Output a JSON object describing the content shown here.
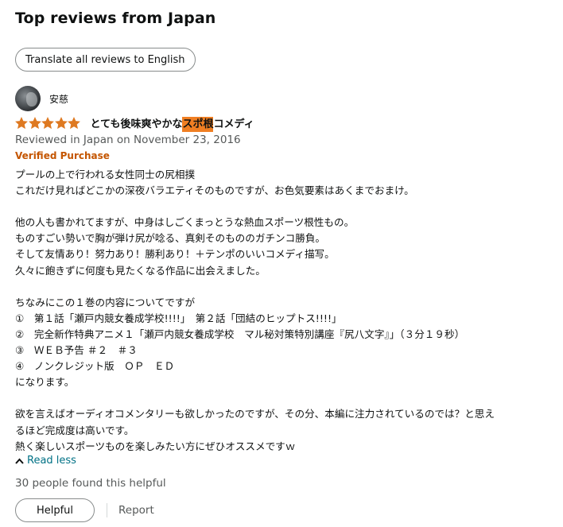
{
  "section": {
    "heading": "Top reviews from Japan",
    "translate_label": "Translate all reviews to English"
  },
  "review": {
    "author": "安慈",
    "rating": 5,
    "rating_max": 5,
    "star_color": "#de7921",
    "title_before": "とても後味爽やかな",
    "title_highlight": "スポ根",
    "title_after": "コメディ",
    "highlight_color": "#f07f23",
    "date": "Reviewed in Japan on November 23, 2016",
    "verified": "Verified Purchase",
    "verified_color": "#c45500",
    "body_lines": [
      "プールの上で行われる女性同士の尻相撲",
      "これだけ見ればどこかの深夜バラエティそのものですが、お色気要素はあくまでおまけ。",
      "",
      "他の人も書かれてますが、中身はしごくまっとうな熱血スポーツ根性もの。",
      "ものすごい勢いで胸が弾け尻が唸る、真剣そのもののガチンコ勝負。",
      "そして友情あり！努力あり！勝利あり！＋テンポのいいコメディ描写。",
      "久々に飽きずに何度も見たくなる作品に出会えました。",
      "",
      "ちなみにこの１巻の内容についてですが",
      "①　第１話「瀬戸内競女養成学校!!!!」　第２話「団結のヒップトス!!!!」",
      "②　完全新作特典アニメ１「瀬戸内競女養成学校　マル秘対策特別講座『尻八文字』」（３分１９秒）",
      "③　ＷＥＢ予告 ＃２　＃３",
      "④　ノンクレジット版　ＯＰ　ＥＤ",
      "になります。",
      "",
      "欲を言えばオーディオコメンタリーも欲しかったのですが、その分、本編に注力されているのでは？と思え",
      "るほど完成度は高いです。",
      "熱く楽しいスポーツものを楽しみたい方にぜひオススメですｗ"
    ],
    "read_less": "Read less",
    "link_color": "#007185",
    "helpful_count": "30 people found this helpful",
    "helpful_label": "Helpful",
    "report_label": "Report"
  }
}
